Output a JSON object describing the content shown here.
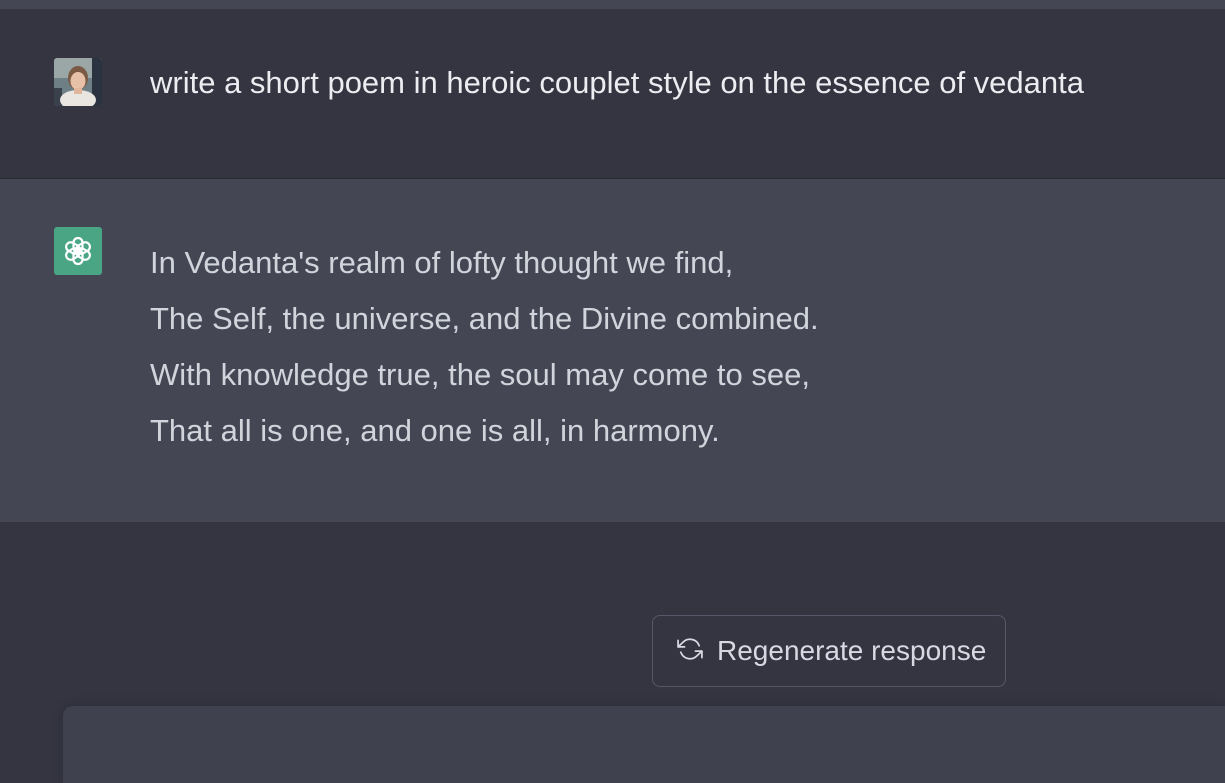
{
  "conversation": {
    "user_message": "write a short poem in heroic couplet style on the essence of vedanta",
    "assistant_lines": [
      "In Vedanta's realm of lofty thought we find,",
      "The Self, the universe, and the Divine combined.",
      "With knowledge true, the soul may come to see,",
      "That all is one, and one is all, in harmony."
    ]
  },
  "actions": {
    "regenerate_label": "Regenerate response"
  },
  "icons": {
    "user_avatar": "user-avatar",
    "assistant": "openai-logo-icon",
    "regenerate": "refresh-icon"
  },
  "colors": {
    "background": "#343541",
    "assistant_bg": "#444654",
    "logo_bg": "#4aa585",
    "composer_bg": "#40414f"
  }
}
